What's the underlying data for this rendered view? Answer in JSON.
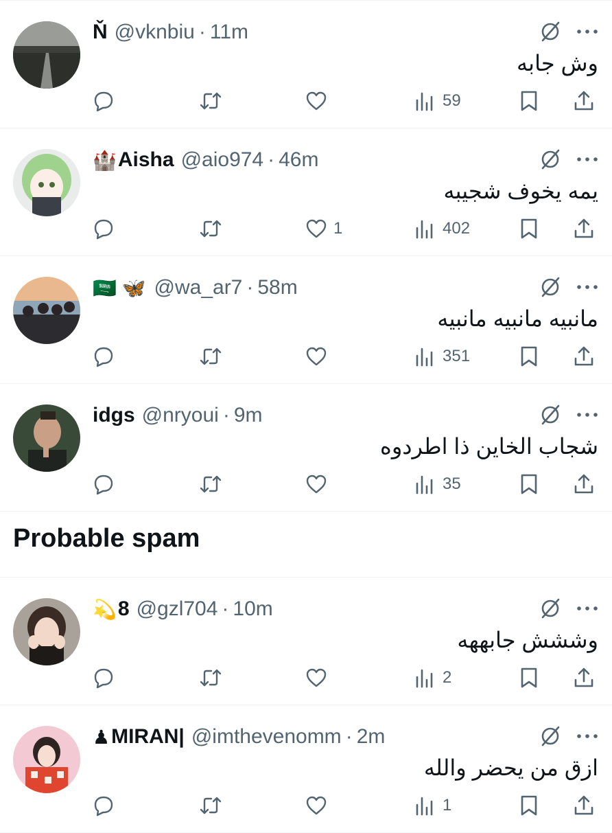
{
  "tweets_top": [
    {
      "name": "Ň",
      "name_emoji": "",
      "handle": "@vknbiu",
      "time": "11m",
      "text": "وش جابه",
      "likes": "",
      "views": "59",
      "avatar": "road"
    },
    {
      "name": "Aisha",
      "name_emoji": "🏰",
      "handle": "@aio974",
      "time": "46m",
      "text": "يمه يخوف شجيبه",
      "likes": "1",
      "views": "402",
      "avatar": "anime"
    },
    {
      "name": "",
      "name_emoji": "🇸🇦 🦋",
      "handle": "@wa_ar7",
      "time": "58m",
      "text": "مانبيه مانبيه مانبيه",
      "likes": "",
      "views": "351",
      "avatar": "group"
    },
    {
      "name": "idgs",
      "name_emoji": "",
      "handle": "@nryoui",
      "time": "9m",
      "text": "شجاب الخاين ذا اطردوه",
      "likes": "",
      "views": "35",
      "avatar": "man"
    }
  ],
  "section": {
    "title": "Probable spam"
  },
  "tweets_spam": [
    {
      "name": "8",
      "name_emoji": "💫",
      "handle": "@gzl704",
      "time": "10m",
      "text": "وششش جابههه",
      "likes": "",
      "views": "2",
      "avatar": "girl"
    },
    {
      "name": "MIRAN|",
      "name_emoji": "♟",
      "handle": "@imthevenomm",
      "time": "2m",
      "text": "ازق من يحضر والله",
      "likes": "",
      "views": "1",
      "avatar": "red"
    }
  ],
  "icons": {
    "reply": "reply-icon",
    "retweet": "retweet-icon",
    "like": "like-icon",
    "views": "views-icon",
    "bookmark": "bookmark-icon",
    "share": "share-icon",
    "grok": "grok-icon",
    "more": "more-icon"
  },
  "colors": {
    "text": "#0f1419",
    "secondary": "#536471",
    "divider": "#eff3f4"
  }
}
